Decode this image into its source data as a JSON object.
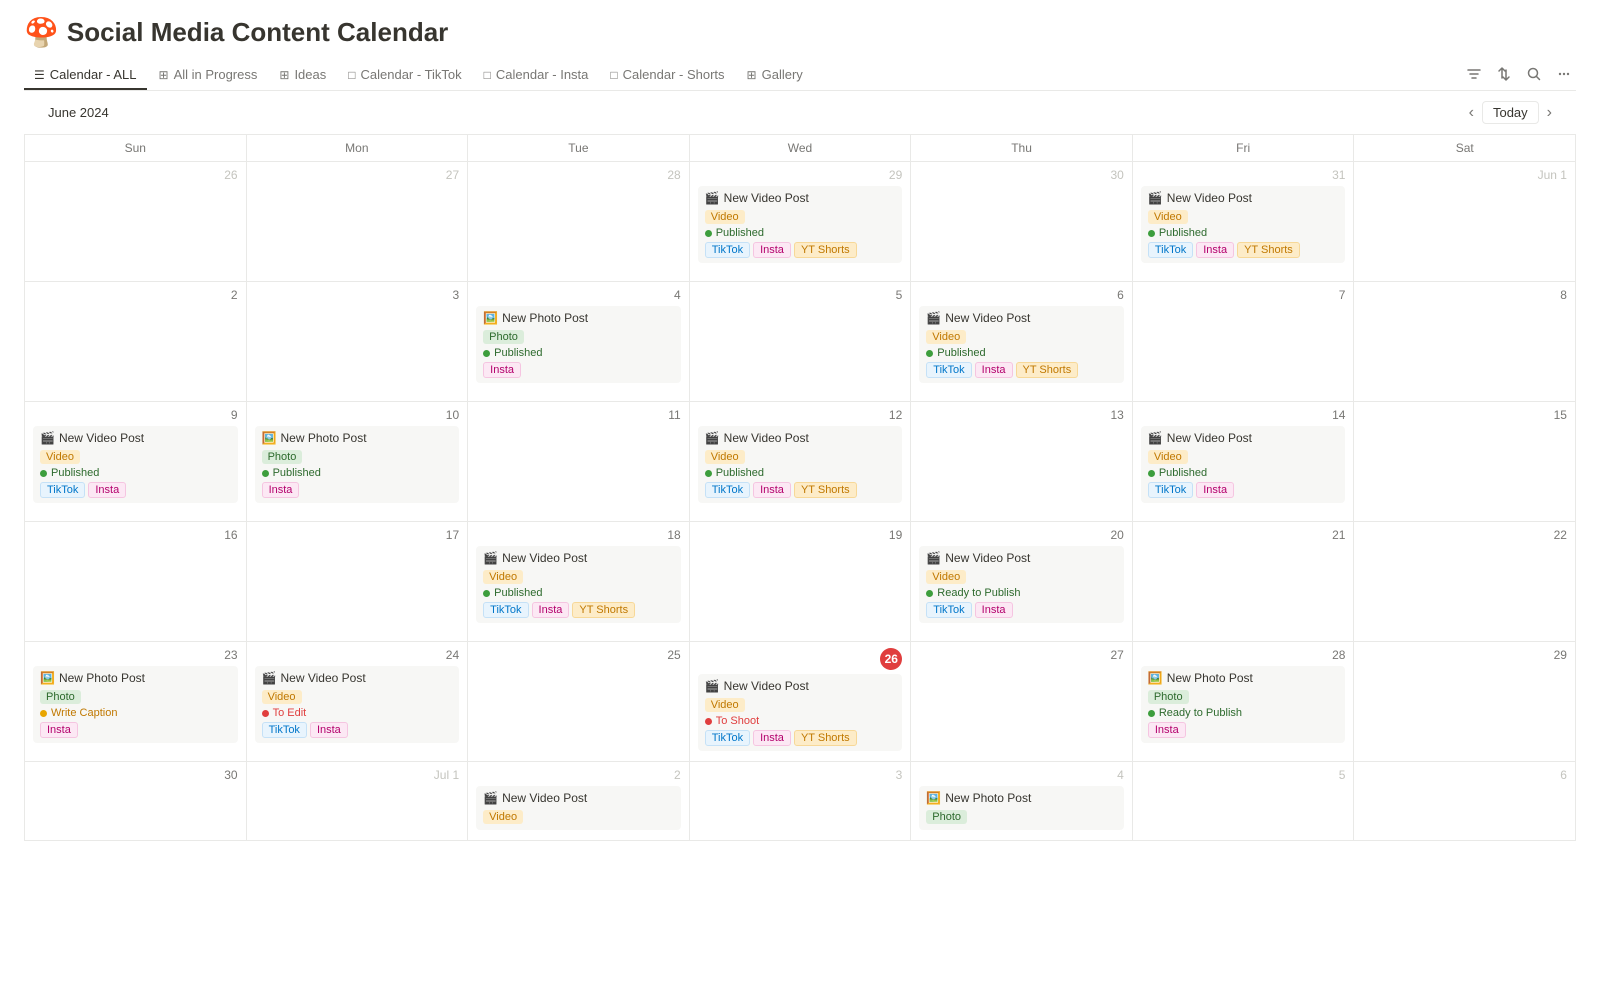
{
  "app": {
    "emoji": "🍄",
    "title": "Social Media Content Calendar"
  },
  "tabs": [
    {
      "id": "calendar-all",
      "icon": "☰",
      "label": "Calendar - ALL",
      "active": true
    },
    {
      "id": "all-in-progress",
      "icon": "⊞",
      "label": "All in Progress",
      "active": false
    },
    {
      "id": "ideas",
      "icon": "⊞",
      "label": "Ideas",
      "active": false
    },
    {
      "id": "calendar-tiktok",
      "icon": "□",
      "label": "Calendar - TikTok",
      "active": false
    },
    {
      "id": "calendar-insta",
      "icon": "□",
      "label": "Calendar - Insta",
      "active": false
    },
    {
      "id": "calendar-shorts",
      "icon": "□",
      "label": "Calendar - Shorts",
      "active": false
    },
    {
      "id": "gallery",
      "icon": "⊞",
      "label": "Gallery",
      "active": false
    }
  ],
  "toolbar": {
    "month_label": "June 2024",
    "today_label": "Today"
  },
  "days": [
    "Sun",
    "Mon",
    "Tue",
    "Wed",
    "Thu",
    "Fri",
    "Sat"
  ],
  "weeks": [
    {
      "cells": [
        {
          "num": "26",
          "other": true,
          "events": []
        },
        {
          "num": "27",
          "other": true,
          "events": []
        },
        {
          "num": "28",
          "other": true,
          "events": []
        },
        {
          "num": "29",
          "other": true,
          "events": [
            {
              "emoji": "🎬",
              "title": "New Video Post",
              "type_tag": {
                "label": "Video",
                "cls": "tag-video"
              },
              "status": {
                "label": "Published",
                "cls": "status-published"
              },
              "platforms": [
                {
                  "label": "TikTok",
                  "cls": "ptag-tiktok"
                },
                {
                  "label": "Insta",
                  "cls": "ptag-insta"
                },
                {
                  "label": "YT Shorts",
                  "cls": "ptag-yt"
                }
              ]
            }
          ]
        },
        {
          "num": "30",
          "other": true,
          "events": []
        },
        {
          "num": "31",
          "other": true,
          "events": [
            {
              "emoji": "🎬",
              "title": "New Video Post",
              "type_tag": {
                "label": "Video",
                "cls": "tag-video"
              },
              "status": {
                "label": "Published",
                "cls": "status-published"
              },
              "platforms": [
                {
                  "label": "TikTok",
                  "cls": "ptag-tiktok"
                },
                {
                  "label": "Insta",
                  "cls": "ptag-insta"
                },
                {
                  "label": "YT Shorts",
                  "cls": "ptag-yt"
                }
              ]
            }
          ]
        },
        {
          "num": "Jun 1",
          "other": true,
          "events": []
        }
      ]
    },
    {
      "cells": [
        {
          "num": "2",
          "events": []
        },
        {
          "num": "3",
          "events": []
        },
        {
          "num": "4",
          "events": [
            {
              "emoji": "🖼️",
              "title": "New Photo Post",
              "type_tag": {
                "label": "Photo",
                "cls": "tag-photo"
              },
              "status": {
                "label": "Published",
                "cls": "status-published"
              },
              "platforms": [
                {
                  "label": "Insta",
                  "cls": "ptag-insta"
                }
              ]
            }
          ]
        },
        {
          "num": "5",
          "events": []
        },
        {
          "num": "6",
          "events": [
            {
              "emoji": "🎬",
              "title": "New Video Post",
              "type_tag": {
                "label": "Video",
                "cls": "tag-video"
              },
              "status": {
                "label": "Published",
                "cls": "status-published"
              },
              "platforms": [
                {
                  "label": "TikTok",
                  "cls": "ptag-tiktok"
                },
                {
                  "label": "Insta",
                  "cls": "ptag-insta"
                },
                {
                  "label": "YT Shorts",
                  "cls": "ptag-yt"
                }
              ]
            }
          ]
        },
        {
          "num": "7",
          "events": []
        },
        {
          "num": "8",
          "events": []
        }
      ]
    },
    {
      "cells": [
        {
          "num": "9",
          "events": [
            {
              "emoji": "🎬",
              "title": "New Video Post",
              "type_tag": {
                "label": "Video",
                "cls": "tag-video"
              },
              "status": {
                "label": "Published",
                "cls": "status-published"
              },
              "platforms": [
                {
                  "label": "TikTok",
                  "cls": "ptag-tiktok"
                },
                {
                  "label": "Insta",
                  "cls": "ptag-insta"
                }
              ]
            }
          ]
        },
        {
          "num": "10",
          "events": [
            {
              "emoji": "🖼️",
              "title": "New Photo Post",
              "type_tag": {
                "label": "Photo",
                "cls": "tag-photo"
              },
              "status": {
                "label": "Published",
                "cls": "status-published"
              },
              "platforms": [
                {
                  "label": "Insta",
                  "cls": "ptag-insta"
                }
              ]
            }
          ]
        },
        {
          "num": "11",
          "events": []
        },
        {
          "num": "12",
          "events": [
            {
              "emoji": "🎬",
              "title": "New Video Post",
              "type_tag": {
                "label": "Video",
                "cls": "tag-video"
              },
              "status": {
                "label": "Published",
                "cls": "status-published"
              },
              "platforms": [
                {
                  "label": "TikTok",
                  "cls": "ptag-tiktok"
                },
                {
                  "label": "Insta",
                  "cls": "ptag-insta"
                },
                {
                  "label": "YT Shorts",
                  "cls": "ptag-yt"
                }
              ]
            }
          ]
        },
        {
          "num": "13",
          "events": []
        },
        {
          "num": "14",
          "events": [
            {
              "emoji": "🎬",
              "title": "New Video Post",
              "type_tag": {
                "label": "Video",
                "cls": "tag-video"
              },
              "status": {
                "label": "Published",
                "cls": "status-published"
              },
              "platforms": [
                {
                  "label": "TikTok",
                  "cls": "ptag-tiktok"
                },
                {
                  "label": "Insta",
                  "cls": "ptag-insta"
                }
              ]
            }
          ]
        },
        {
          "num": "15",
          "events": []
        }
      ]
    },
    {
      "cells": [
        {
          "num": "16",
          "events": []
        },
        {
          "num": "17",
          "events": []
        },
        {
          "num": "18",
          "events": [
            {
              "emoji": "🎬",
              "title": "New Video Post",
              "type_tag": {
                "label": "Video",
                "cls": "tag-video"
              },
              "status": {
                "label": "Published",
                "cls": "status-published"
              },
              "platforms": [
                {
                  "label": "TikTok",
                  "cls": "ptag-tiktok"
                },
                {
                  "label": "Insta",
                  "cls": "ptag-insta"
                },
                {
                  "label": "YT Shorts",
                  "cls": "ptag-yt"
                }
              ]
            }
          ]
        },
        {
          "num": "19",
          "events": []
        },
        {
          "num": "20",
          "events": [
            {
              "emoji": "🎬",
              "title": "New Video Post",
              "type_tag": {
                "label": "Video",
                "cls": "tag-video"
              },
              "status": {
                "label": "Ready to Publish",
                "cls": "status-ready"
              },
              "platforms": [
                {
                  "label": "TikTok",
                  "cls": "ptag-tiktok"
                },
                {
                  "label": "Insta",
                  "cls": "ptag-insta"
                }
              ]
            }
          ]
        },
        {
          "num": "21",
          "events": []
        },
        {
          "num": "22",
          "events": []
        }
      ]
    },
    {
      "cells": [
        {
          "num": "23",
          "events": [
            {
              "emoji": "🖼️",
              "title": "New Photo Post",
              "type_tag": {
                "label": "Photo",
                "cls": "tag-photo"
              },
              "status": {
                "label": "Write Caption",
                "cls": "status-write"
              },
              "platforms": [
                {
                  "label": "Insta",
                  "cls": "ptag-insta"
                }
              ]
            }
          ]
        },
        {
          "num": "24",
          "events": [
            {
              "emoji": "🎬",
              "title": "New Video Post",
              "type_tag": {
                "label": "Video",
                "cls": "tag-video"
              },
              "status": {
                "label": "To Edit",
                "cls": "status-toedit"
              },
              "platforms": [
                {
                  "label": "TikTok",
                  "cls": "ptag-tiktok"
                },
                {
                  "label": "Insta",
                  "cls": "ptag-insta"
                }
              ]
            }
          ]
        },
        {
          "num": "25",
          "events": []
        },
        {
          "num": "26",
          "today": true,
          "events": [
            {
              "emoji": "🎬",
              "title": "New Video Post",
              "type_tag": {
                "label": "Video",
                "cls": "tag-video"
              },
              "status": {
                "label": "To Shoot",
                "cls": "status-toshoot"
              },
              "platforms": [
                {
                  "label": "TikTok",
                  "cls": "ptag-tiktok"
                },
                {
                  "label": "Insta",
                  "cls": "ptag-insta"
                },
                {
                  "label": "YT Shorts",
                  "cls": "ptag-yt"
                }
              ]
            }
          ]
        },
        {
          "num": "27",
          "events": []
        },
        {
          "num": "28",
          "events": [
            {
              "emoji": "🖼️",
              "title": "New Photo Post",
              "type_tag": {
                "label": "Photo",
                "cls": "tag-photo"
              },
              "status": {
                "label": "Ready to Publish",
                "cls": "status-ready"
              },
              "platforms": [
                {
                  "label": "Insta",
                  "cls": "ptag-insta"
                }
              ]
            }
          ]
        },
        {
          "num": "29",
          "events": []
        }
      ]
    },
    {
      "last": true,
      "cells": [
        {
          "num": "30",
          "events": []
        },
        {
          "num": "Jul 1",
          "other": true,
          "events": []
        },
        {
          "num": "2",
          "other": true,
          "events": [
            {
              "emoji": "🎬",
              "title": "New Video Post",
              "type_tag": {
                "label": "Video",
                "cls": "tag-video"
              },
              "status": null,
              "platforms": []
            }
          ]
        },
        {
          "num": "3",
          "other": true,
          "events": []
        },
        {
          "num": "4",
          "other": true,
          "events": [
            {
              "emoji": "🖼️",
              "title": "New Photo Post",
              "type_tag": {
                "label": "Photo",
                "cls": "tag-photo"
              },
              "status": null,
              "platforms": []
            }
          ]
        },
        {
          "num": "5",
          "other": true,
          "events": []
        },
        {
          "num": "6",
          "other": true,
          "events": []
        }
      ]
    }
  ]
}
